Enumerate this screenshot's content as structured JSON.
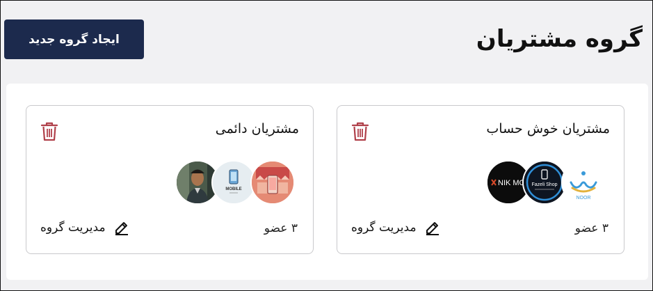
{
  "page": {
    "title": "گروه مشتریان",
    "create_button_label": "ایجاد گروه جدید"
  },
  "groups": [
    {
      "name": "مشتریان خوش حساب",
      "member_count_label": "۳ عضو",
      "manage_label": "مدیریت گروه",
      "avatars": [
        {
          "icon": "noor-logo",
          "text": "NOOR"
        },
        {
          "icon": "fazeli-shop-logo",
          "text": "Fazeli Shop"
        },
        {
          "icon": "nik-mo-logo",
          "text": "NIK MO"
        }
      ]
    },
    {
      "name": "مشتریان دائمی",
      "member_count_label": "۳ عضو",
      "manage_label": "مدیریت گروه",
      "avatars": [
        {
          "icon": "shop-phone-photo",
          "text": ""
        },
        {
          "icon": "mobile-store-logo",
          "text": "MOBILE"
        },
        {
          "icon": "man-portrait-photo",
          "text": ""
        }
      ]
    }
  ],
  "colors": {
    "primary": "#1c2a4d",
    "danger": "#b0404a",
    "background": "#f1f1f3"
  }
}
